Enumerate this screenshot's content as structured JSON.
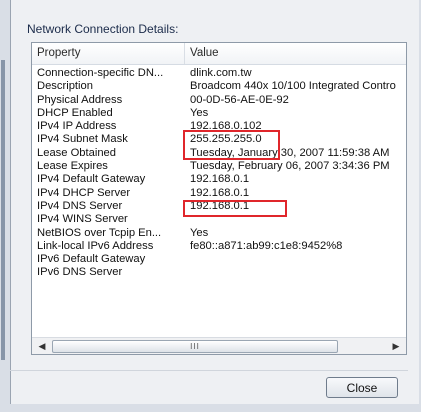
{
  "group_label": "Network Connection Details:",
  "list": {
    "columns": [
      "Property",
      "Value"
    ],
    "rows": [
      {
        "property": "Connection-specific DN...",
        "value": "dlink.com.tw"
      },
      {
        "property": "Description",
        "value": "Broadcom 440x 10/100 Integrated Contro"
      },
      {
        "property": "Physical Address",
        "value": "00-0D-56-AE-0E-92"
      },
      {
        "property": "DHCP Enabled",
        "value": "Yes"
      },
      {
        "property": "IPv4 IP Address",
        "value": "192.168.0.102"
      },
      {
        "property": "IPv4 Subnet Mask",
        "value": "255.255.255.0"
      },
      {
        "property": "Lease Obtained",
        "value": "Tuesday, January 30, 2007 11:59:38 AM"
      },
      {
        "property": "Lease Expires",
        "value": "Tuesday, February 06, 2007 3:34:36 PM"
      },
      {
        "property": "IPv4 Default Gateway",
        "value": "192.168.0.1"
      },
      {
        "property": "IPv4 DHCP Server",
        "value": "192.168.0.1"
      },
      {
        "property": "IPv4 DNS Server",
        "value": "192.168.0.1"
      },
      {
        "property": "IPv4 WINS Server",
        "value": ""
      },
      {
        "property": "NetBIOS over Tcpip En...",
        "value": "Yes"
      },
      {
        "property": "Link-local IPv6 Address",
        "value": "fe80::a871:ab99:c1e8:9452%8"
      },
      {
        "property": "IPv6 Default Gateway",
        "value": ""
      },
      {
        "property": "IPv6 DNS Server",
        "value": ""
      }
    ]
  },
  "scrollbar": {
    "left_icon": "scroll-left-arrow-icon",
    "right_icon": "scroll-right-arrow-icon",
    "thumb_grip": "III"
  },
  "buttons": {
    "close": "Close"
  },
  "colors": {
    "highlight_box": "#e0262b"
  }
}
